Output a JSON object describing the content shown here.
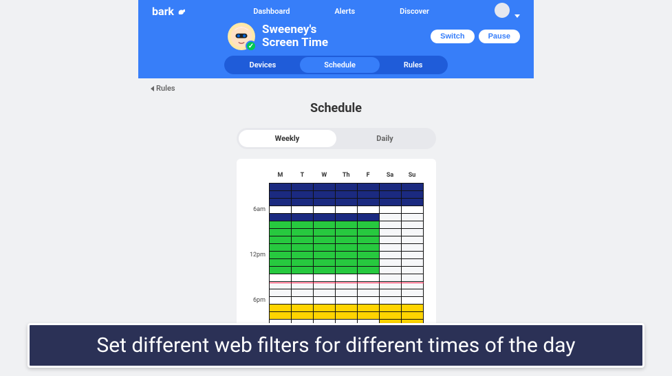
{
  "brand": "bark",
  "nav": {
    "dashboard": "Dashboard",
    "alerts": "Alerts",
    "discover": "Discover"
  },
  "title": {
    "line1": "Sweeney's",
    "line2": "Screen Time"
  },
  "buttons": {
    "switch": "Switch",
    "pause": "Pause"
  },
  "subnav": {
    "devices": "Devices",
    "schedule": "Schedule",
    "rules": "Rules"
  },
  "breadcrumb": "Rules",
  "page_title": "Schedule",
  "segments": {
    "weekly": "Weekly",
    "daily": "Daily"
  },
  "days": [
    "M",
    "T",
    "W",
    "Th",
    "F",
    "Sa",
    "Su"
  ],
  "time_labels": {
    "r4": "6am",
    "r10": "12pm",
    "r16": "6pm"
  },
  "chart_data": {
    "type": "heatmap",
    "days": [
      "M",
      "T",
      "W",
      "Th",
      "F",
      "Sa",
      "Su"
    ],
    "rows_shown": 20,
    "legend": {
      "navy": "#1b2a80",
      "white": "#ffffff",
      "green": "#27c93f",
      "grey": "#f6f7f9",
      "yellow": "#ffd400"
    },
    "current_time_row": 12,
    "cells": [
      [
        "navy",
        "navy",
        "navy",
        "navy",
        "navy",
        "navy",
        "navy"
      ],
      [
        "navy",
        "navy",
        "navy",
        "navy",
        "navy",
        "navy",
        "navy"
      ],
      [
        "navy",
        "navy",
        "navy",
        "navy",
        "navy",
        "navy",
        "navy"
      ],
      [
        "white",
        "white",
        "white",
        "white",
        "white",
        "white",
        "white"
      ],
      [
        "navy",
        "navy",
        "navy",
        "navy",
        "navy",
        "grey",
        "grey"
      ],
      [
        "green",
        "green",
        "green",
        "green",
        "green",
        "grey",
        "grey"
      ],
      [
        "green",
        "green",
        "green",
        "green",
        "green",
        "grey",
        "grey"
      ],
      [
        "green",
        "green",
        "green",
        "green",
        "green",
        "grey",
        "grey"
      ],
      [
        "green",
        "green",
        "green",
        "green",
        "green",
        "grey",
        "grey"
      ],
      [
        "green",
        "green",
        "green",
        "green",
        "green",
        "grey",
        "grey"
      ],
      [
        "green",
        "green",
        "green",
        "green",
        "green",
        "grey",
        "grey"
      ],
      [
        "green",
        "green",
        "green",
        "green",
        "green",
        "grey",
        "grey"
      ],
      [
        "white",
        "white",
        "white",
        "white",
        "white",
        "grey",
        "grey"
      ],
      [
        "grey",
        "grey",
        "grey",
        "grey",
        "grey",
        "grey",
        "grey"
      ],
      [
        "grey",
        "grey",
        "grey",
        "grey",
        "grey",
        "grey",
        "grey"
      ],
      [
        "white",
        "white",
        "white",
        "white",
        "white",
        "grey",
        "white"
      ],
      [
        "yellow",
        "yellow",
        "yellow",
        "yellow",
        "yellow",
        "yellow",
        "yellow"
      ],
      [
        "yellow",
        "yellow",
        "yellow",
        "yellow",
        "yellow",
        "yellow",
        "yellow"
      ],
      [
        "white",
        "white",
        "white",
        "white",
        "white",
        "yellow",
        "yellow"
      ],
      [
        "navy",
        "navy",
        "navy",
        "navy",
        "navy",
        "white",
        "white"
      ]
    ]
  },
  "caption": "Set different web filters for different times of the day"
}
